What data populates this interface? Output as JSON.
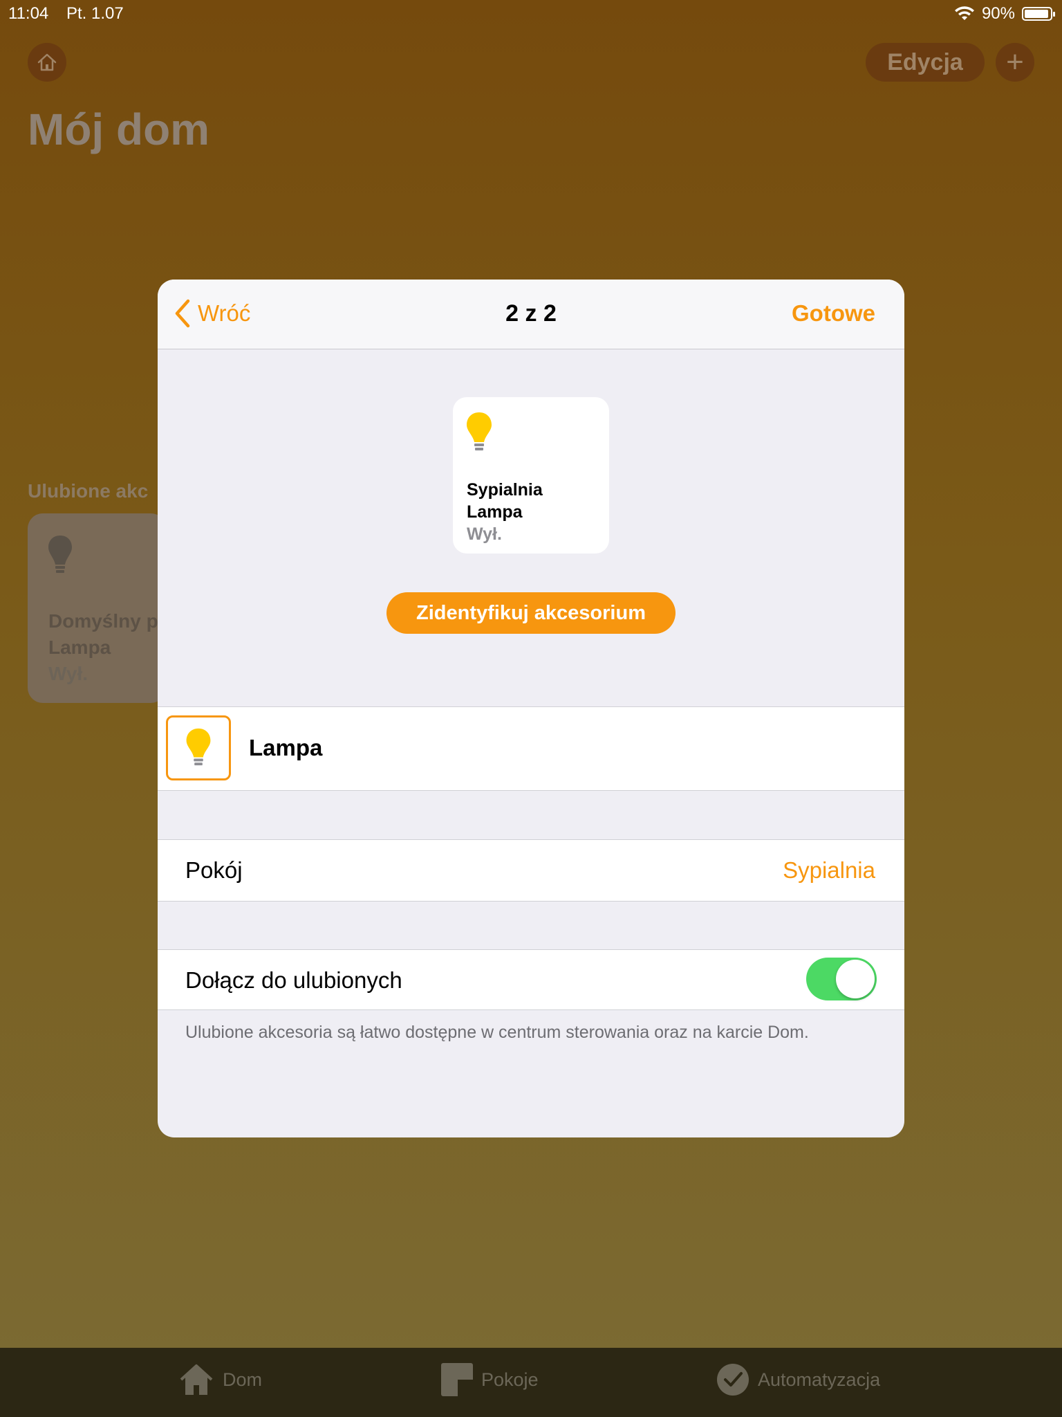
{
  "status_bar": {
    "time": "11:04",
    "date": "Pt. 1.07",
    "battery": "90%"
  },
  "background": {
    "edit_label": "Edycja",
    "plus_label": "+",
    "page_title": "Mój dom",
    "section_label": "Ulubione akc",
    "tile": {
      "line1": "Domyślny p",
      "line2": "Lampa",
      "line3": "Wył."
    }
  },
  "modal": {
    "back_label": "Wróć",
    "title": "2 z 2",
    "done_label": "Gotowe",
    "tile": {
      "room": "Sypialnia",
      "name": "Lampa",
      "state": "Wył."
    },
    "identify_label": "Zidentyfikuj akcesorium",
    "accessory_name": "Lampa",
    "room_label": "Pokój",
    "room_value": "Sypialnia",
    "favorites_label": "Dołącz do ulubionych",
    "favorites_on": true,
    "footnote": "Ulubione akcesoria są łatwo dostępne w centrum sterowania oraz na karcie Dom."
  },
  "tabs": [
    {
      "label": "Dom",
      "icon": "house-icon"
    },
    {
      "label": "Pokoje",
      "icon": "rooms-icon"
    },
    {
      "label": "Automatyzacja",
      "icon": "automation-icon"
    }
  ],
  "colors": {
    "accent": "#f7960f",
    "toggle_on": "#4cd964",
    "bulb": "#ffcc00"
  }
}
